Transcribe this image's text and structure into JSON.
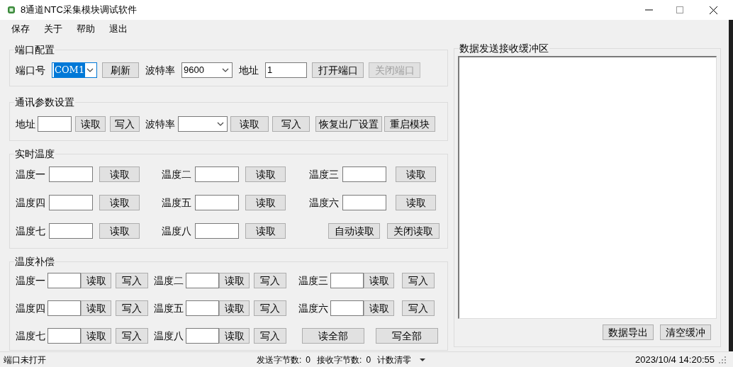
{
  "window": {
    "title": "8通道NTC采集模块调试软件"
  },
  "menu": [
    {
      "label": "保存"
    },
    {
      "label": "关于"
    },
    {
      "label": "帮助"
    },
    {
      "label": "退出"
    }
  ],
  "port_config": {
    "title": "端口配置",
    "port_label": "端口号",
    "port": {
      "value": "COM1",
      "selected": true
    },
    "refresh": "刷新",
    "baud_label": "波特率",
    "baud": "9600",
    "address_label": "地址",
    "address": "1",
    "open_button": {
      "label": "打开端口",
      "disabled": false
    },
    "close_button": {
      "label": "关闭端口",
      "disabled": true
    }
  },
  "comm_params": {
    "title": "通讯参数设置",
    "address_label": "地址",
    "address_read": "读取",
    "address_write": "写入",
    "baud_label": "波特率",
    "baud_read": "读取",
    "baud_write": "写入",
    "factory_reset": "恢复出厂设置",
    "restart": "重启模块"
  },
  "realtime": {
    "title": "实时温度",
    "channels": [
      {
        "label": "温度一",
        "button": "读取"
      },
      {
        "label": "温度二",
        "button": "读取"
      },
      {
        "label": "温度三",
        "button": "读取"
      },
      {
        "label": "温度四",
        "button": "读取"
      },
      {
        "label": "温度五",
        "button": "读取"
      },
      {
        "label": "温度六",
        "button": "读取"
      },
      {
        "label": "温度七",
        "button": "读取"
      },
      {
        "label": "温度八",
        "button": "读取"
      }
    ],
    "auto_button": "自动读取",
    "stop_button": "关闭读取"
  },
  "compensation": {
    "title": "温度补偿",
    "channels": [
      {
        "label": "温度一",
        "read": "读取",
        "write": "写入"
      },
      {
        "label": "温度二",
        "read": "读取",
        "write": "写入"
      },
      {
        "label": "温度三",
        "read": "读取",
        "write": "写入"
      },
      {
        "label": "温度四",
        "read": "读取",
        "write": "写入"
      },
      {
        "label": "温度五",
        "read": "读取",
        "write": "写入"
      },
      {
        "label": "温度六",
        "read": "读取",
        "write": "写入"
      },
      {
        "label": "温度七",
        "read": "读取",
        "write": "写入"
      },
      {
        "label": "温度八",
        "read": "读取",
        "write": "写入"
      }
    ],
    "read_all": "读全部",
    "write_all": "写全部"
  },
  "buffer": {
    "title": "数据发送接收缓冲区",
    "buttons": [
      "数据导出",
      "清空缓冲"
    ]
  },
  "status_bar": {
    "port_status": "端口未打开",
    "sent_label": "发送字节数:",
    "sent": "0",
    "received_label": "接收字节数:",
    "received": "0",
    "reset": "计数清零",
    "time": "2023/10/4 14:20:55"
  }
}
